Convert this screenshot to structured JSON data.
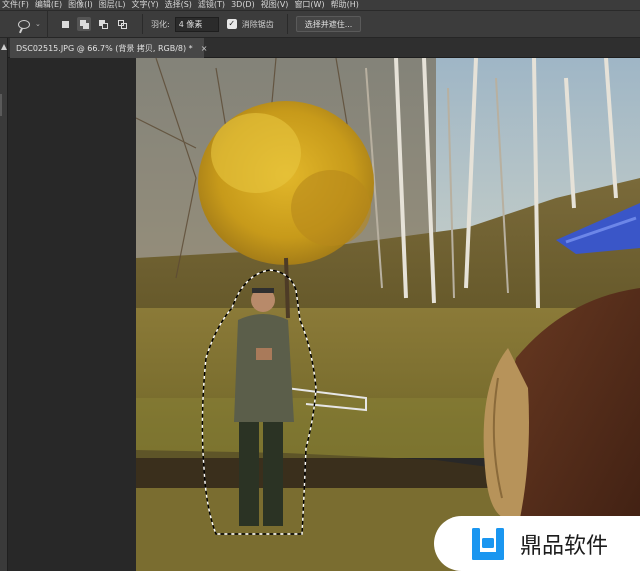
{
  "menu": {
    "items": [
      "文件(F)",
      "编辑(E)",
      "图像(I)",
      "图层(L)",
      "文字(Y)",
      "选择(S)",
      "滤镜(T)",
      "3D(D)",
      "视图(V)",
      "窗口(W)",
      "帮助(H)"
    ]
  },
  "options": {
    "tool_icon": "lasso-icon",
    "feather_label": "羽化:",
    "feather_value": "4 像素",
    "antialias_label": "消除锯齿",
    "antialias_checked": true,
    "select_mask_button": "选择并遮住..."
  },
  "document_tab": {
    "title": "DSC02515.JPG @ 66.7% (背景 拷贝, RGB/8) *",
    "close": "×"
  },
  "watermark": {
    "text": "鼎品软件",
    "logo_color": "#1a96f0"
  },
  "colors": {
    "ui_dark": "#282828",
    "ui_panel": "#3c3c3c",
    "tree_yellow": "#c8a41e",
    "grass": "#8a7a3a"
  }
}
